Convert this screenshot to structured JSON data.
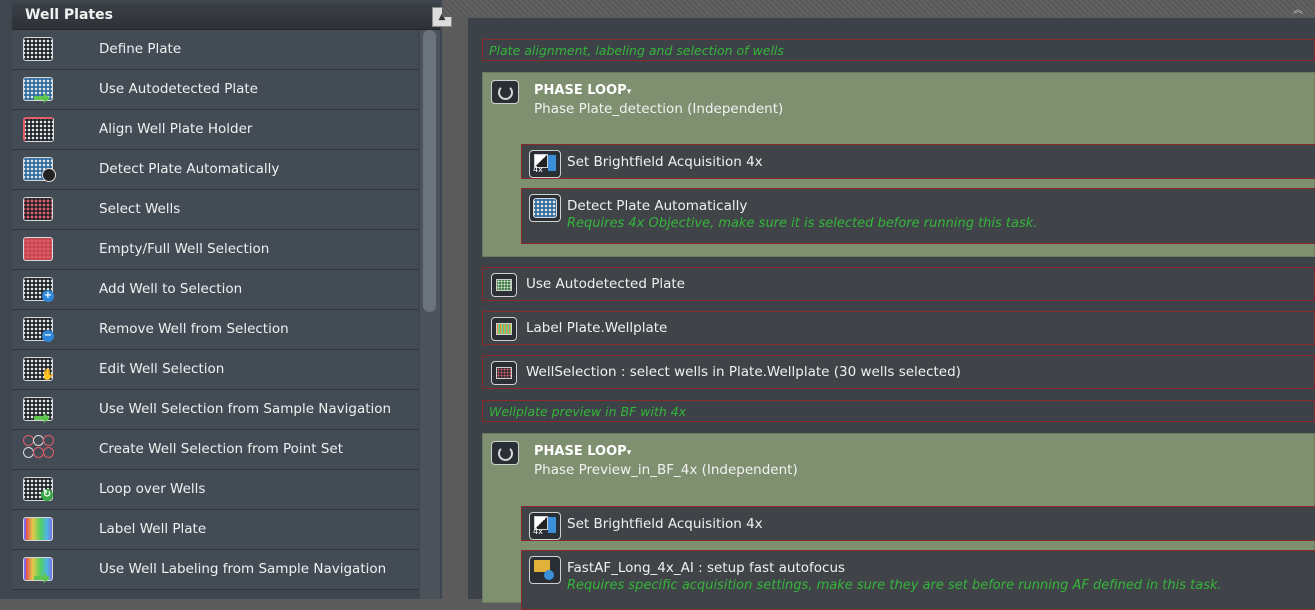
{
  "left_panel": {
    "title": "Well Plates",
    "items": [
      {
        "label": "Define Plate",
        "icon": "plate-icon"
      },
      {
        "label": "Use Autodetected Plate",
        "icon": "plate-arrow-icon"
      },
      {
        "label": "Align Well Plate Holder",
        "icon": "plate-align-icon"
      },
      {
        "label": "Detect Plate Automatically",
        "icon": "plate-detect-icon"
      },
      {
        "label": "Select Wells",
        "icon": "plate-select-icon"
      },
      {
        "label": "Empty/Full Well Selection",
        "icon": "plate-full-icon"
      },
      {
        "label": "Add Well to Selection",
        "icon": "plate-add-icon"
      },
      {
        "label": "Remove Well from Selection",
        "icon": "plate-remove-icon"
      },
      {
        "label": "Edit Well Selection",
        "icon": "plate-hand-icon"
      },
      {
        "label": "Use Well Selection from Sample Navigation",
        "icon": "plate-arrow-icon"
      },
      {
        "label": "Create Well Selection from Point Set",
        "icon": "point-set-icon"
      },
      {
        "label": "Loop over Wells",
        "icon": "plate-loop-icon"
      },
      {
        "label": "Label Well Plate",
        "icon": "plate-label-icon"
      },
      {
        "label": "Use Well Labeling from Sample Navigation",
        "icon": "plate-label-arrow-icon"
      }
    ]
  },
  "workflow": {
    "comment1": "Plate alignment, labeling and selection of wells",
    "loop1": {
      "title": "PHASE LOOP",
      "marker": "▾",
      "subtitle": "Phase Plate_detection (Independent)",
      "task1": "Set Brightfield Acquisition 4x",
      "task2": "Detect Plate Automatically",
      "task2_note": "Requires 4x Objective, make sure it is selected before running this task."
    },
    "task_use_plate": "Use Autodetected Plate",
    "task_label_plate": "Label Plate.Wellplate",
    "task_well_selection": "WellSelection : select wells in Plate.Wellplate (30 wells selected)",
    "comment2": "Wellplate preview in BF with 4x",
    "loop2": {
      "title": "PHASE LOOP",
      "marker": "▾",
      "subtitle": "Phase Preview_in_BF_4x (Independent)",
      "task1": "Set Brightfield Acquisition 4x",
      "task2": "FastAF_Long_4x_AI : setup fast autofocus",
      "task2_note": "Requires specific acquisition settings, make sure they are set before running AF defined in this task."
    }
  }
}
